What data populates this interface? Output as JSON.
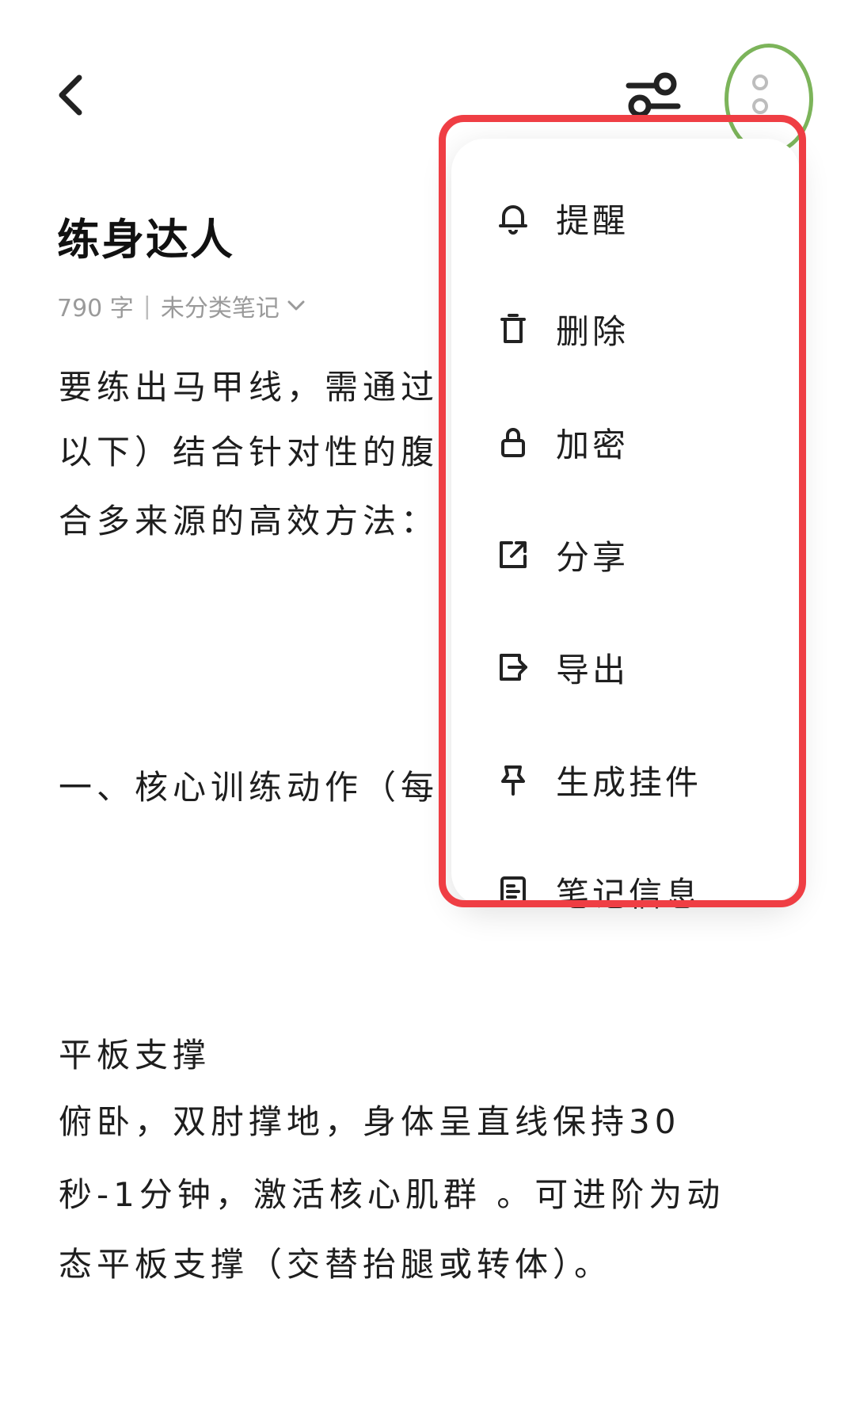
{
  "header": {
    "back_icon": "chevron-left-icon",
    "settings_icon": "tune-sliders-icon",
    "more_icon": "more-vertical-icon"
  },
  "note": {
    "title": "练身达人",
    "word_count": "790 字",
    "separator": "|",
    "category": "未分类笔记",
    "lines": [
      "要练出马甲线，需通过",
      "以下）结合针对性的腹",
      "合多来源的高效方法：",
      "一、核心训练动作（每",
      "平板支撑",
      "俯卧，双肘撑地，身体呈直线保持30",
      "秒-1分钟，激活核心肌群 。可进阶为动",
      "态平板支撑（交替抬腿或转体）。"
    ]
  },
  "menu": {
    "items": [
      {
        "label": "提醒",
        "icon": "bell-icon"
      },
      {
        "label": "删除",
        "icon": "trash-icon"
      },
      {
        "label": "加密",
        "icon": "lock-icon"
      },
      {
        "label": "分享",
        "icon": "share-icon"
      },
      {
        "label": "导出",
        "icon": "export-icon"
      },
      {
        "label": "生成挂件",
        "icon": "pin-icon"
      },
      {
        "label": "笔记信息",
        "icon": "note-info-icon"
      }
    ]
  },
  "colors": {
    "highlight_red": "#ef3e44",
    "highlight_green": "#7cb45a"
  }
}
